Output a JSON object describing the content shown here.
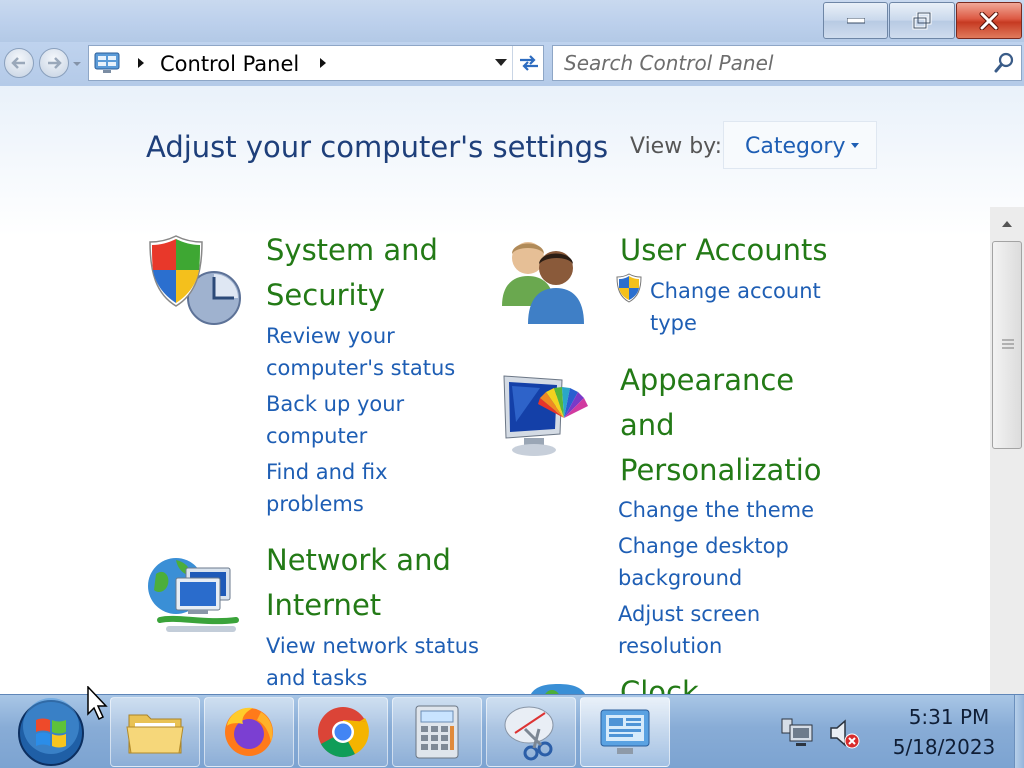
{
  "window": {
    "buttons": {
      "minimize": "minimize",
      "maximize": "restore",
      "close": "close"
    }
  },
  "address_bar": {
    "location": "Control Panel",
    "icons": [
      "control-panel-icon",
      "refresh-icon"
    ]
  },
  "search": {
    "placeholder": "Search Control Panel"
  },
  "header": {
    "title": "Adjust your computer's settings",
    "view_by_label": "View by:",
    "view_by_value": "Category"
  },
  "categories": {
    "system_security": {
      "title_line1": "System and",
      "title_line2": "Security",
      "links": [
        {
          "line1": "Review your",
          "line2": "computer's status"
        },
        {
          "line1": "Back up your",
          "line2": "computer"
        },
        {
          "line1": "Find and fix",
          "line2": "problems"
        }
      ]
    },
    "network": {
      "title_line1": "Network and",
      "title_line2": "Internet",
      "links": [
        {
          "line1": "View network status",
          "line2": "and tasks"
        }
      ]
    },
    "user_accounts": {
      "title": "User Accounts",
      "links": [
        {
          "line1": "Change account",
          "line2": "type"
        }
      ]
    },
    "appearance": {
      "title_line1": "Appearance",
      "title_line2": "and",
      "title_line3": "Personalizatio",
      "links": [
        {
          "line1": "Change the theme"
        },
        {
          "line1": "Change desktop",
          "line2": "background"
        },
        {
          "line1": "Adjust screen",
          "line2": "resolution"
        }
      ]
    },
    "clock_partial": {
      "title": "Clock"
    }
  },
  "taskbar": {
    "pinned": [
      "file-explorer",
      "firefox",
      "chrome",
      "calculator",
      "snipping-tool",
      "control-panel"
    ],
    "active": "control-panel",
    "time": "5:31 PM",
    "date": "5/18/2023"
  },
  "colors": {
    "heading_green": "#237a16",
    "link_blue": "#1e5eb4",
    "title_blue": "#1e3f7a"
  }
}
